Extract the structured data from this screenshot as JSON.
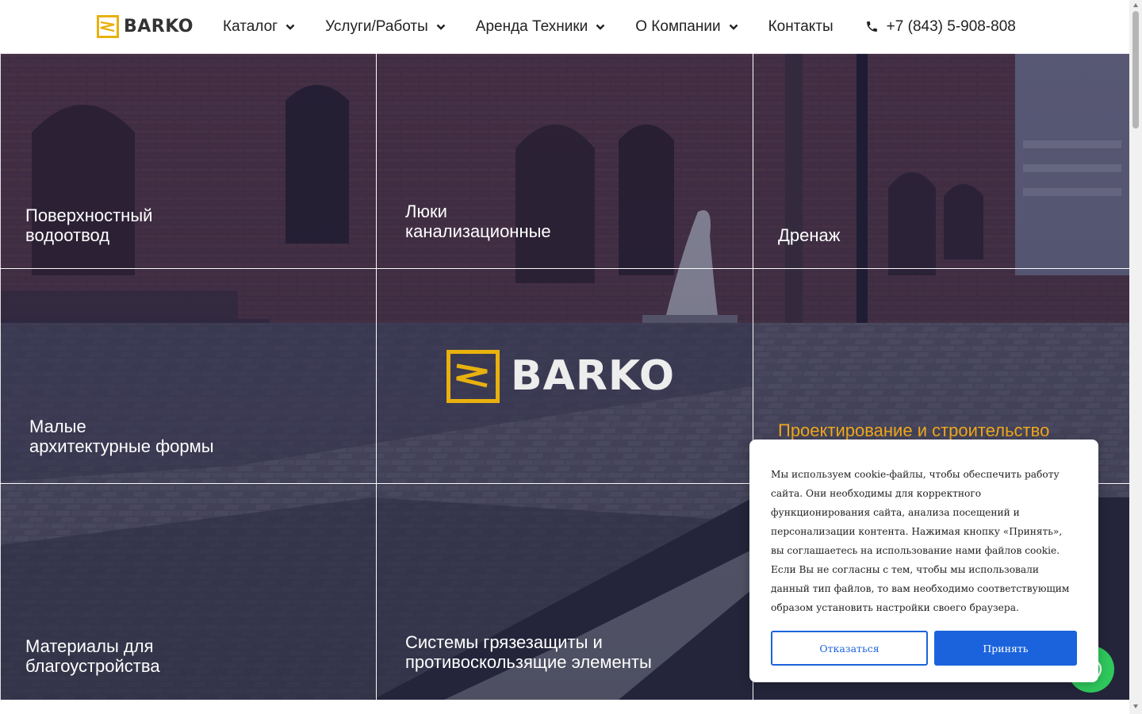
{
  "header": {
    "logo_text": "BARKO",
    "nav": [
      {
        "label": "Каталог",
        "has_dropdown": true
      },
      {
        "label": "Услуги/Работы",
        "has_dropdown": true
      },
      {
        "label": "Аренда Техники",
        "has_dropdown": true
      },
      {
        "label": "О Компании",
        "has_dropdown": true
      },
      {
        "label": "Контакты",
        "has_dropdown": false
      }
    ],
    "phone": "+7 (843) 5-908-808"
  },
  "tiles": [
    {
      "line1": "Поверхностный",
      "line2": "водоотвод"
    },
    {
      "line1": "Люки",
      "line2": "канализационные"
    },
    {
      "line1": "Дренаж",
      "line2": ""
    },
    {
      "line1": "Малые",
      "line2": "архитектурные формы"
    },
    {
      "line1": "Проектирование и строительство",
      "line2": ""
    },
    {
      "line1": "Материалы для",
      "line2": "благоустройства"
    },
    {
      "line1": "Системы грязезащиты и",
      "line2": "противоскользящие элементы"
    }
  ],
  "center_logo_text": "BARKO",
  "cookie": {
    "text": "Мы используем cookie-файлы, чтобы обеспечить работу сайта. Они необходимы для корректного функционирования сайта, анализа посещений и персонализации контента. Нажимая кнопку «Принять», вы соглашаетесь на использование нами файлов cookie. Если Вы не согласны с тем, чтобы мы использовали данный тип файлов, то вам необходимо соответствующим образом установить настройки своего браузера.",
    "decline_label": "Отказаться",
    "accept_label": "Принять"
  },
  "colors": {
    "accent_yellow": "#e8b10e",
    "accent_orange_text": "#f0a81c",
    "button_blue": "#1b63dc",
    "chat_green": "#2fc85c"
  }
}
